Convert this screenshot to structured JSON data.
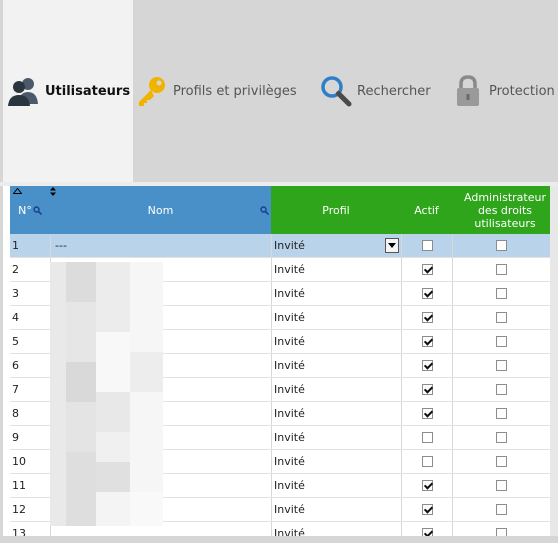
{
  "toolbar": {
    "items": [
      {
        "label": "Utilisateurs",
        "icon": "users-icon",
        "active": true
      },
      {
        "label": "Profils et privilèges",
        "icon": "key-icon",
        "active": false
      },
      {
        "label": "Rechercher",
        "icon": "magnifier-icon",
        "active": false
      },
      {
        "label": "Protection",
        "icon": "padlock-icon",
        "active": false
      }
    ]
  },
  "grid": {
    "columns": {
      "num": "N°",
      "nom": "Nom",
      "profil": "Profil",
      "actif": "Actif",
      "admin": "Administrateur des droits utilisateurs"
    },
    "rows": [
      {
        "num": "1",
        "nom": "---",
        "profil": "Invité",
        "actif": false,
        "admin": false,
        "selected": true
      },
      {
        "num": "2",
        "nom": "",
        "profil": "Invité",
        "actif": true,
        "admin": false
      },
      {
        "num": "3",
        "nom": "",
        "profil": "Invité",
        "actif": true,
        "admin": false
      },
      {
        "num": "4",
        "nom": "",
        "profil": "Invité",
        "actif": true,
        "admin": false
      },
      {
        "num": "5",
        "nom": "",
        "profil": "Invité",
        "actif": true,
        "admin": false
      },
      {
        "num": "6",
        "nom": "",
        "profil": "Invité",
        "actif": true,
        "admin": false
      },
      {
        "num": "7",
        "nom": "",
        "profil": "Invité",
        "actif": true,
        "admin": false
      },
      {
        "num": "8",
        "nom": "",
        "profil": "Invité",
        "actif": true,
        "admin": false
      },
      {
        "num": "9",
        "nom": "",
        "profil": "Invité",
        "actif": false,
        "admin": false
      },
      {
        "num": "10",
        "nom": "",
        "profil": "Invité",
        "actif": false,
        "admin": false
      },
      {
        "num": "11",
        "nom": "",
        "profil": "Invité",
        "actif": true,
        "admin": false
      },
      {
        "num": "12",
        "nom": "",
        "profil": "Invité",
        "actif": true,
        "admin": false
      },
      {
        "num": "13",
        "nom": "",
        "profil": "Invité",
        "actif": true,
        "admin": false
      }
    ]
  },
  "colors": {
    "header_blue": "#4a90c8",
    "header_green": "#2fa51c",
    "selected_row": "#b9d3ea",
    "toolbar_bg": "#d6d6d6"
  }
}
